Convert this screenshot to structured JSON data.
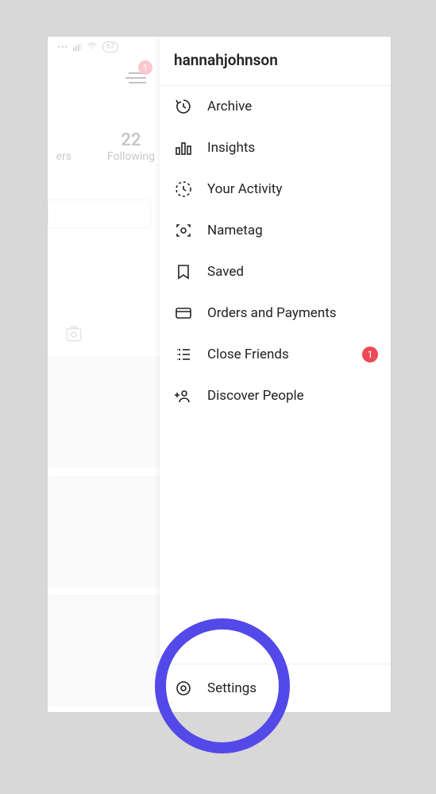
{
  "status": {
    "battery": "67"
  },
  "hamburger_badge": "1",
  "profile": {
    "followers_cut_label": "ers",
    "following_count": "22",
    "following_label": "Following"
  },
  "menu": {
    "username": "hannahjohnson",
    "items": [
      {
        "label": "Archive"
      },
      {
        "label": "Insights"
      },
      {
        "label": "Your Activity"
      },
      {
        "label": "Nametag"
      },
      {
        "label": "Saved"
      },
      {
        "label": "Orders and Payments"
      },
      {
        "label": "Close Friends",
        "badge": "1"
      },
      {
        "label": "Discover People"
      }
    ],
    "settings_label": "Settings"
  }
}
